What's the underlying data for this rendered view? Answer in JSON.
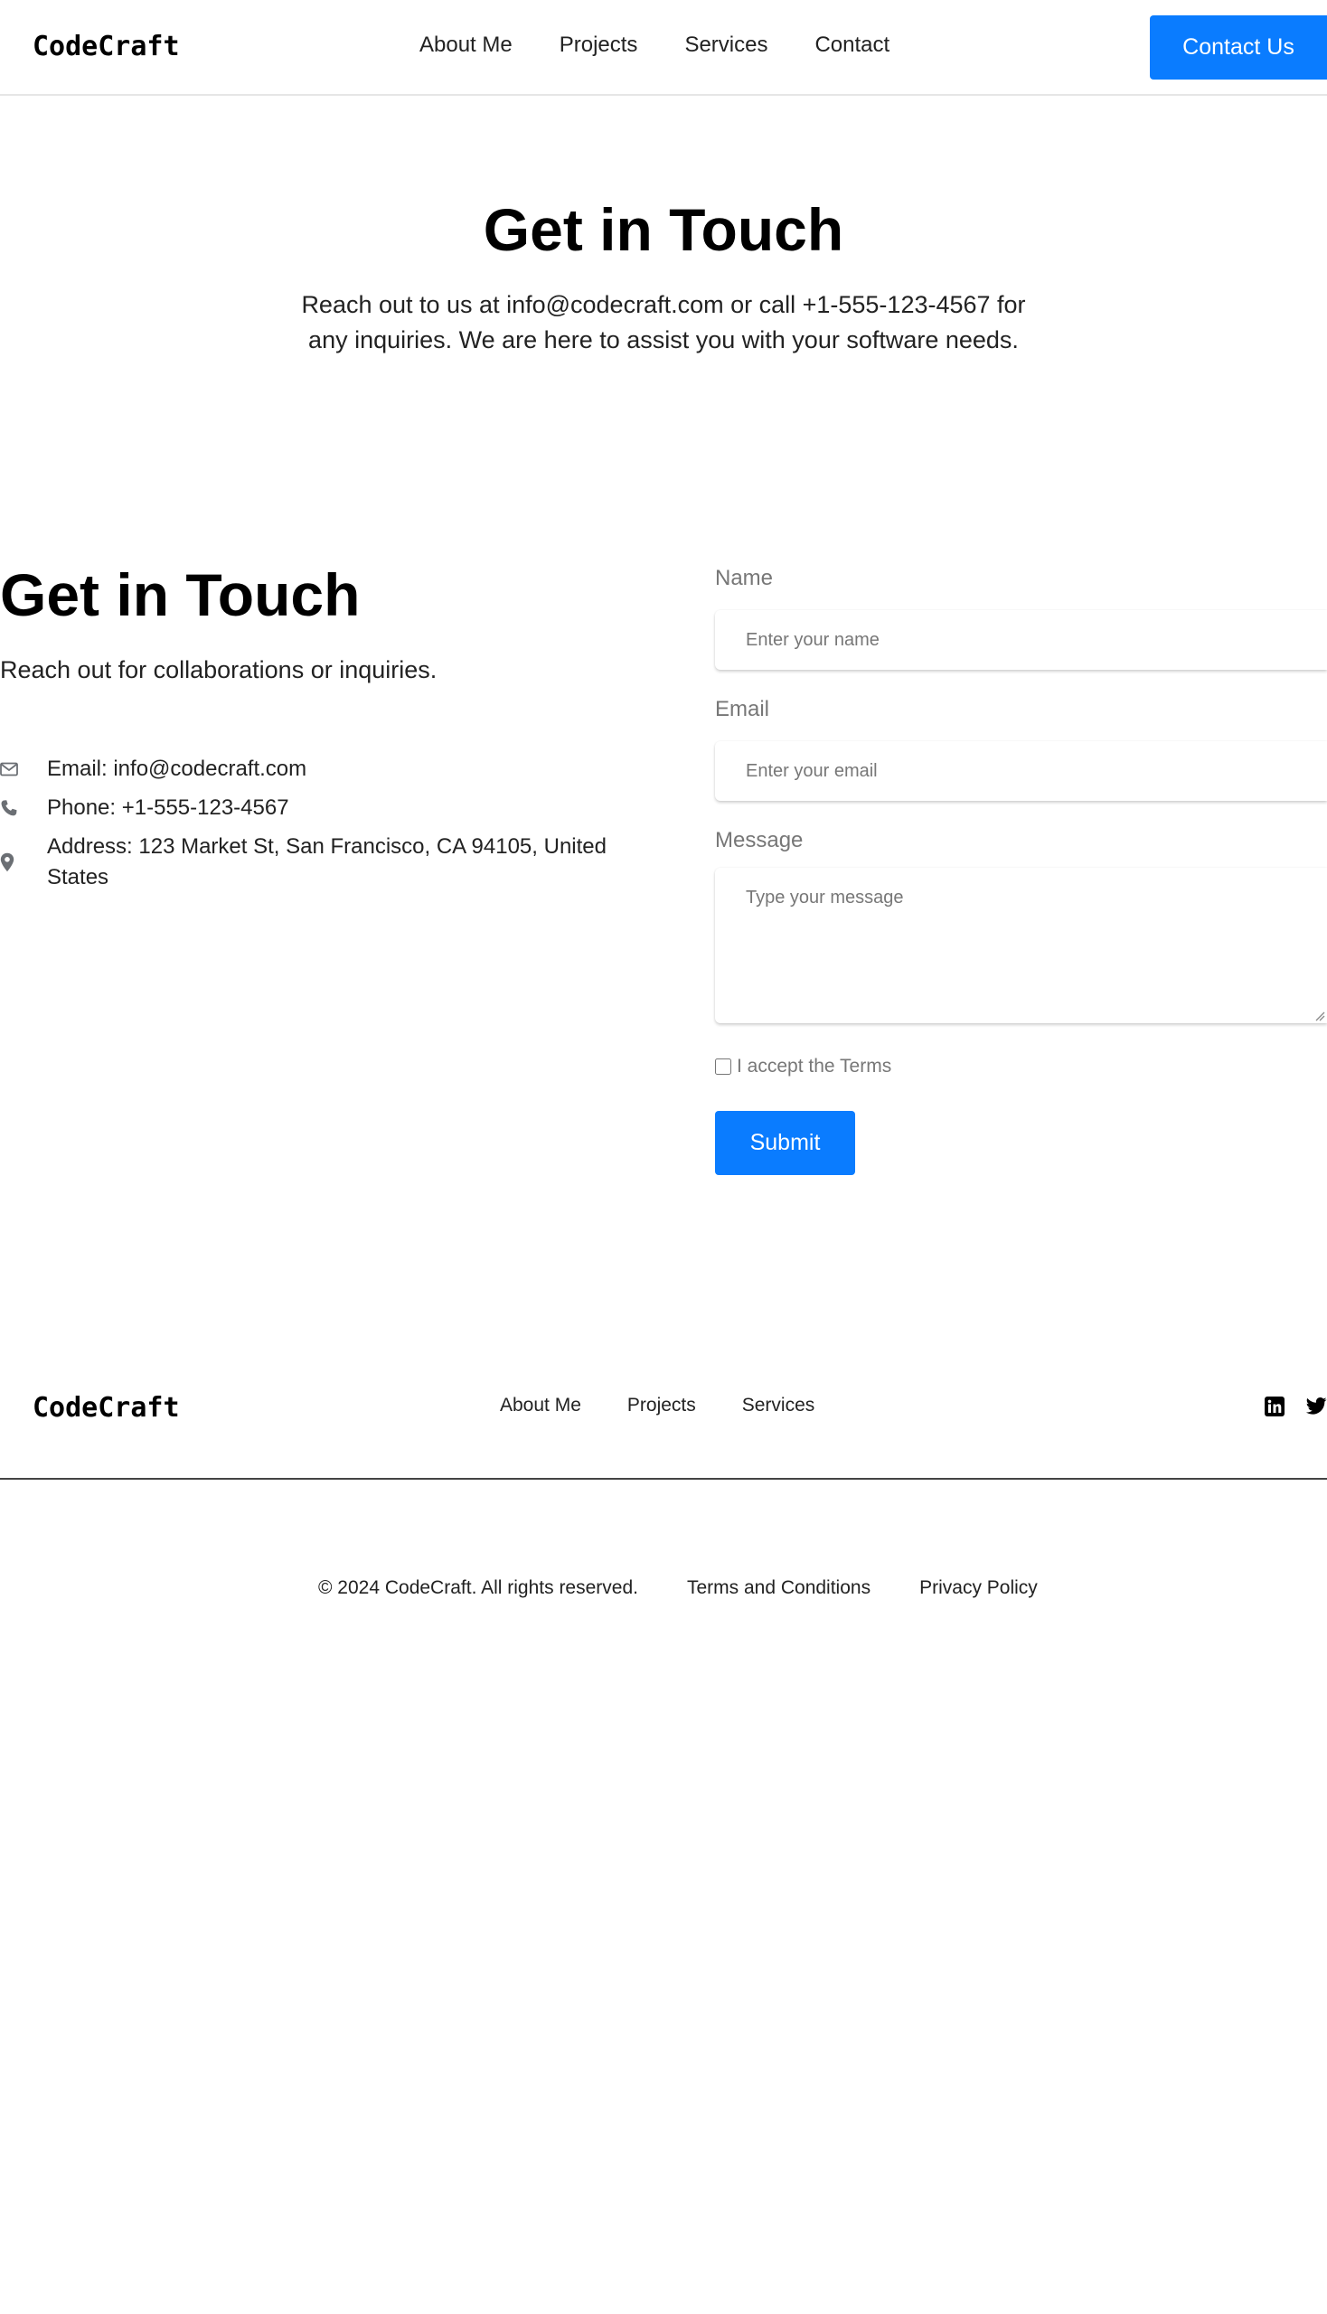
{
  "header": {
    "logo": "CodeCraft",
    "nav": [
      "About Me",
      "Projects",
      "Services",
      "Contact"
    ],
    "cta_label": "Contact Us"
  },
  "hero": {
    "title": "Get in Touch",
    "text": "Reach out to us at info@codecraft.com or call +1-555-123-4567 for any inquiries. We are here to assist you with your software needs."
  },
  "contact": {
    "title": "Get in Touch",
    "subtitle": "Reach out for collaborations or inquiries.",
    "info": {
      "email": "Email: info@codecraft.com",
      "phone": "Phone: +1-555-123-4567",
      "address": "Address: 123 Market St, San Francisco, CA 94105, United States"
    },
    "icons": [
      "envelope-icon",
      "phone-icon",
      "map-pin-icon"
    ]
  },
  "form": {
    "name_label": "Name",
    "name_placeholder": "Enter your name",
    "email_label": "Email",
    "email_placeholder": "Enter your email",
    "message_label": "Message",
    "message_placeholder": "Type your message",
    "terms_label": "I accept the Terms",
    "submit_label": "Submit"
  },
  "footer": {
    "logo": "CodeCraft",
    "nav": [
      "About Me",
      "Projects",
      "Services"
    ],
    "social_icons": [
      "linkedin-icon",
      "twitter-icon"
    ],
    "copyright": "© 2024 CodeCraft. All rights reserved.",
    "terms_link": "Terms and Conditions",
    "privacy_link": "Privacy Policy"
  },
  "colors": {
    "accent": "#0a7cff",
    "text": "#111111",
    "muted": "#777777"
  }
}
